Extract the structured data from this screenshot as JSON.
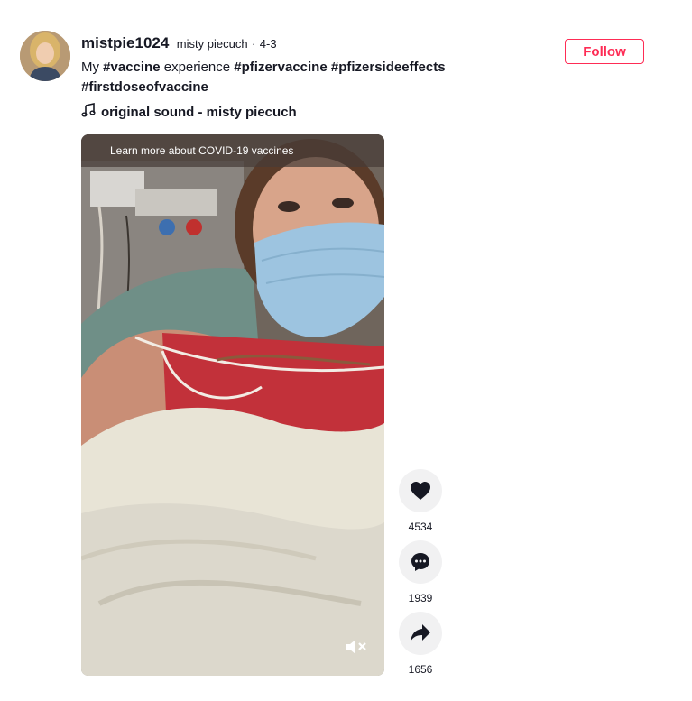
{
  "post": {
    "username": "mistpie1024",
    "nickname": "misty piecuch",
    "separator": "·",
    "date": "4-3",
    "caption": {
      "prefix": "My",
      "hashtag_vaccine": "#vaccine",
      "middle": "experience",
      "hashtag_pfizervaccine": "#pfizervaccine",
      "hashtag_pfizersideeffects": "#pfizersideeffects",
      "hashtag_firstdose": "#firstdoseofvaccine"
    },
    "sound": "original sound - misty piecuch",
    "follow_label": "Follow"
  },
  "video": {
    "banner": "Learn more about COVID-19 vaccines",
    "muted": true
  },
  "actions": {
    "likes": "4534",
    "comments": "1939",
    "shares": "1656"
  },
  "colors": {
    "accent": "#fe2c55",
    "action_bg": "#f1f1f2"
  },
  "icons": [
    "music-note-icon",
    "heart-icon",
    "comment-icon",
    "share-icon",
    "muted-speaker-icon"
  ]
}
